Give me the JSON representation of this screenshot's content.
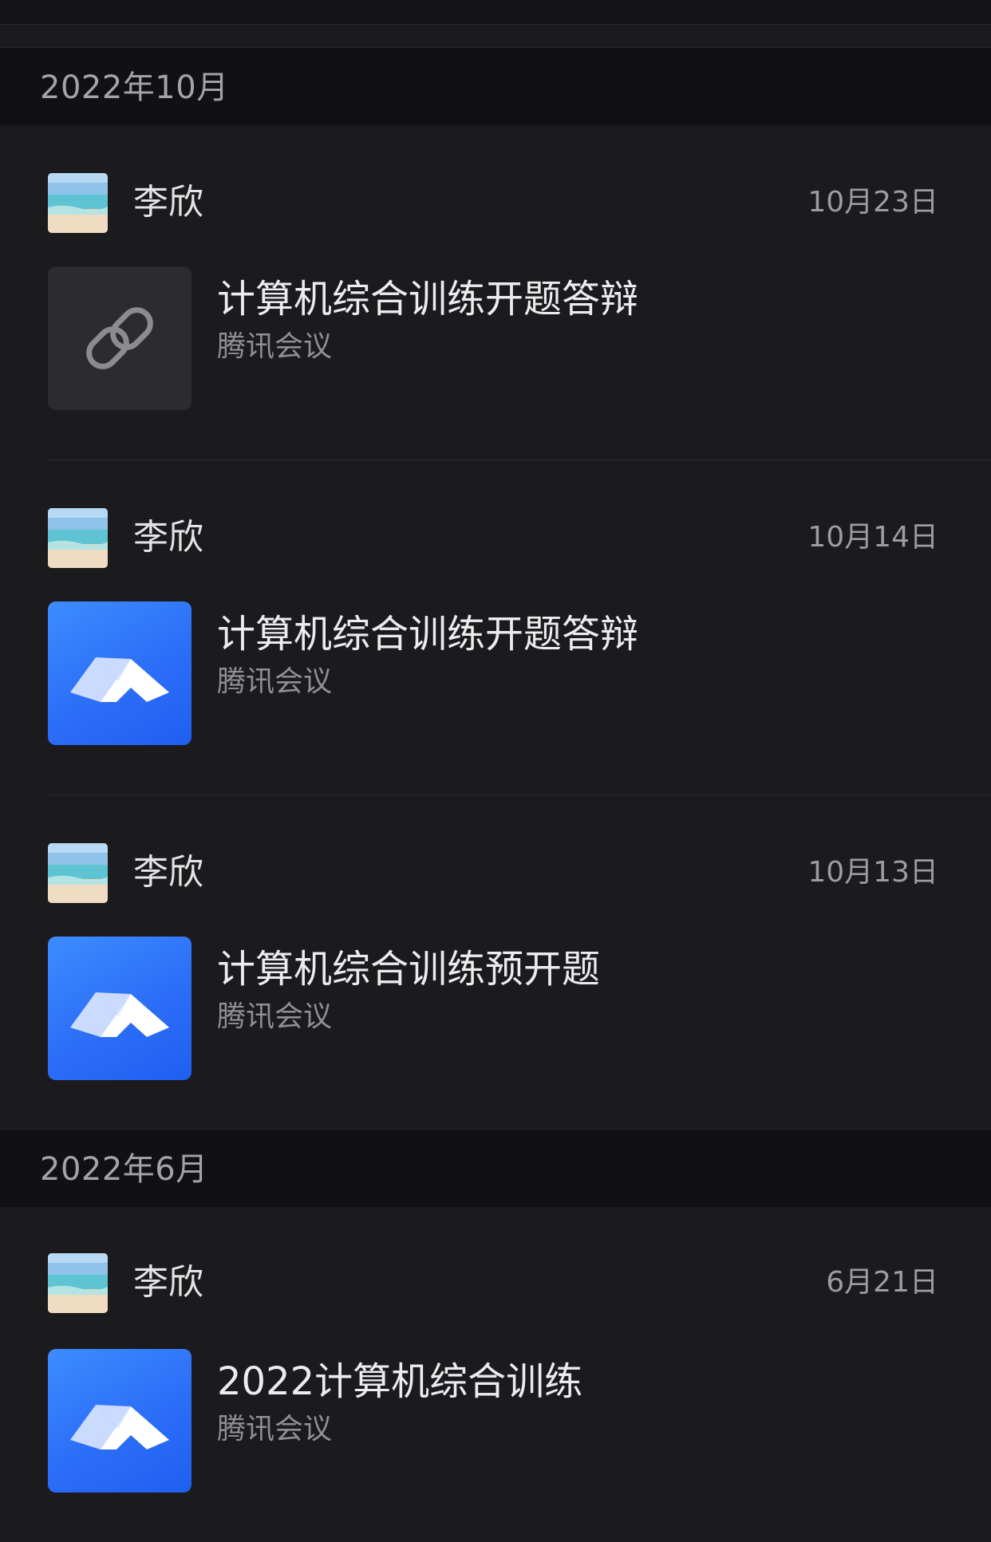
{
  "sections": [
    {
      "title": "2022年10月",
      "items": [
        {
          "sender": "李欣",
          "date": "10月23日",
          "title": "计算机综合训练开题答辩",
          "source": "腾讯会议",
          "thumb_icon": "link-icon"
        },
        {
          "sender": "李欣",
          "date": "10月14日",
          "title": "计算机综合训练开题答辩",
          "source": "腾讯会议",
          "thumb_icon": "tencent-meeting-icon"
        },
        {
          "sender": "李欣",
          "date": "10月13日",
          "title": "计算机综合训练预开题",
          "source": "腾讯会议",
          "thumb_icon": "tencent-meeting-icon"
        }
      ]
    },
    {
      "title": "2022年6月",
      "items": [
        {
          "sender": "李欣",
          "date": "6月21日",
          "title": "2022计算机综合训练",
          "source": "腾讯会议",
          "thumb_icon": "tencent-meeting-icon"
        }
      ]
    }
  ],
  "colors": {
    "background": "#1b1b1d",
    "section_header": "#111113",
    "meeting_blue": "#2c6ef7",
    "link_tile": "#2c2c2f"
  }
}
